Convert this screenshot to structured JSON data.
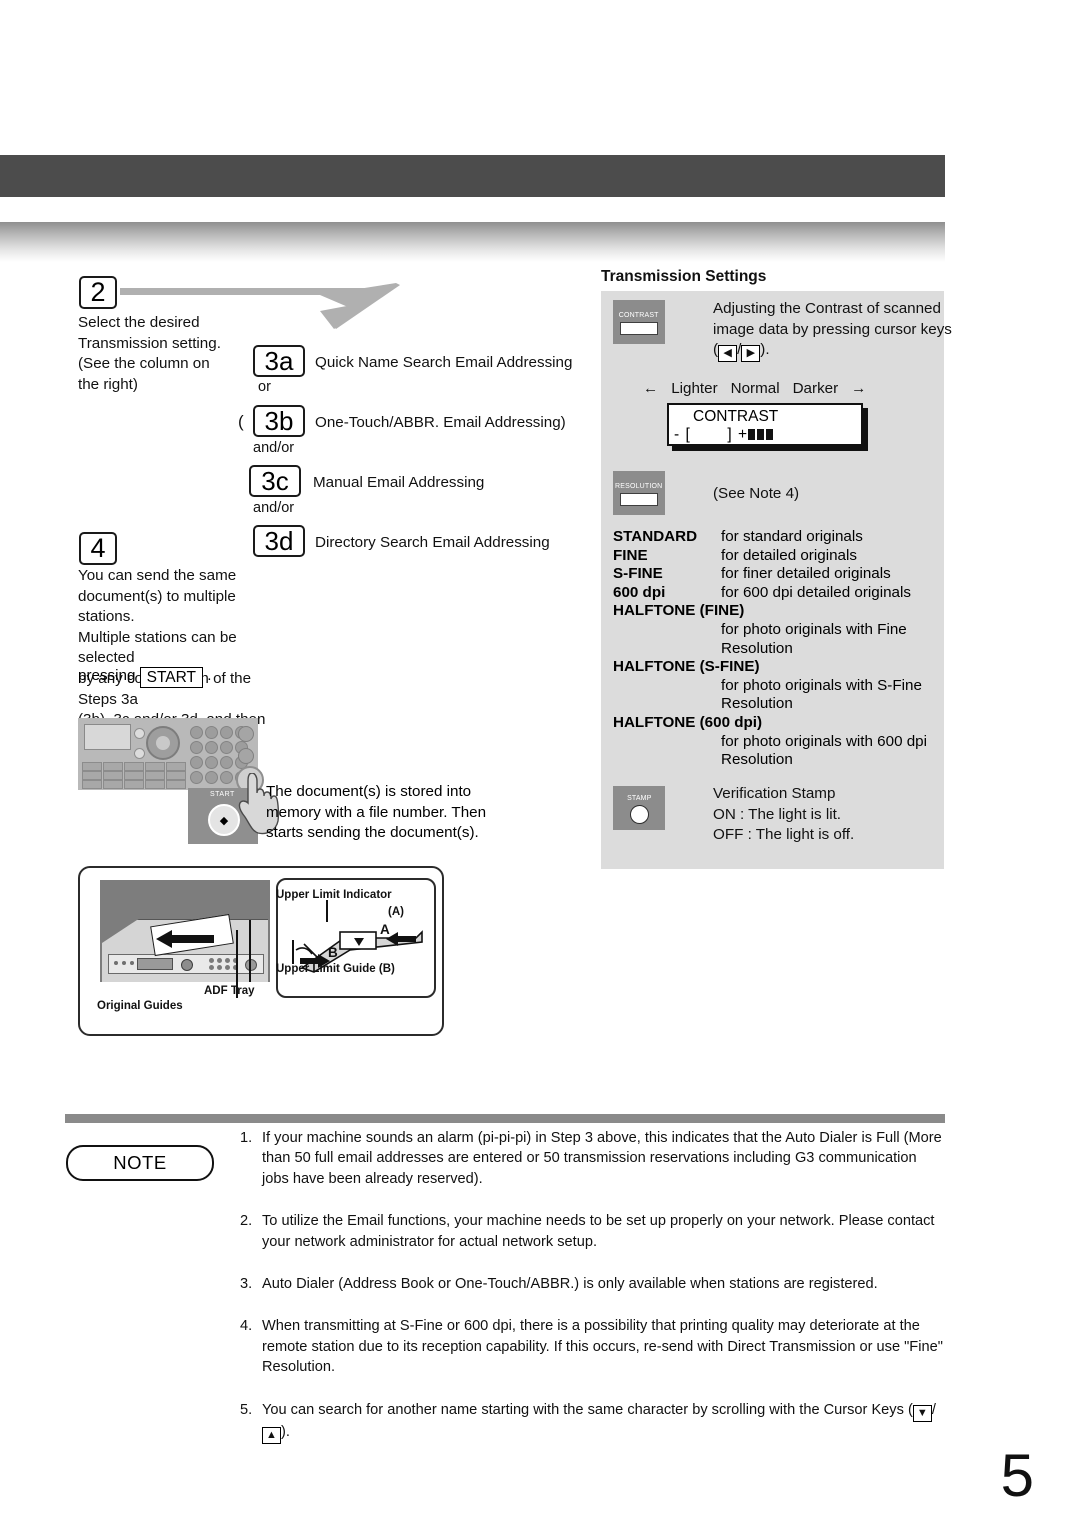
{
  "page": {
    "number": "5"
  },
  "steps": {
    "step2": {
      "number": "2",
      "text": "Select the desired\nTransmission setting.\n(See the column on\nthe right)"
    },
    "step4": {
      "number": "4",
      "text": "You can send the same\ndocument(s) to multiple stations.\nMultiple stations can be selected\nby any combination of the Steps 3a\n(3b), 3c and/or 3d, and then",
      "press_prefix": "pressing",
      "start_key": "START",
      "press_suffix": "."
    },
    "substeps": [
      {
        "id": "3a",
        "label": "Quick Name Search Email Addressing",
        "connector_after": "or"
      },
      {
        "id": "3b",
        "label": "One-Touch/ABBR. Email Addressing)",
        "paren_before": "(",
        "connector_after": "and/or"
      },
      {
        "id": "3c",
        "label": "Manual Email Addressing",
        "connector_after": "and/or"
      },
      {
        "id": "3d",
        "label": "Directory Search Email Addressing",
        "connector_after": ""
      }
    ]
  },
  "control_panel": {
    "start_button_label": "START",
    "caption": "The document(s) is stored into memory with a file number. Then starts sending the document(s)."
  },
  "adf_figure": {
    "upper_limit_indicator": "Upper Limit Indicator",
    "marker_a_paren": "(A)",
    "upper_limit_guide": "Upper Limit Guide (B)",
    "adf_tray": "ADF Tray",
    "original_guides": "Original Guides",
    "letter_a": "A",
    "letter_b": "B"
  },
  "transmission_settings": {
    "title": "Transmission Settings",
    "contrast": {
      "button_caption": "CONTRAST",
      "description_part1": "Adjusting the Contrast of scanned image data by pressing cursor keys (",
      "left_key": "◀",
      "slash": "/",
      "right_key": "▶",
      "description_part2": ").",
      "scale_left_arrow": "←",
      "scale_lighter": "Lighter",
      "scale_normal": "Normal",
      "scale_darker": "Darker",
      "scale_right_arrow": "→",
      "lcd_line1": "CONTRAST",
      "lcd_line2_prefix": "- [",
      "lcd_line2_mid": "] +",
      "lcd_bars_filled": 3
    },
    "resolution": {
      "button_caption": "RESOLUTION",
      "see_note": "(See Note 4)",
      "items": [
        {
          "name": "STANDARD",
          "desc": "for standard originals",
          "stacked": false
        },
        {
          "name": "FINE",
          "desc": "for detailed originals",
          "stacked": false
        },
        {
          "name": "S-FINE",
          "desc": "for finer detailed originals",
          "stacked": false
        },
        {
          "name": "600 dpi",
          "desc": "for 600 dpi detailed originals",
          "stacked": false
        },
        {
          "name": "HALFTONE (FINE)",
          "desc": "for photo originals with Fine Resolution",
          "stacked": true
        },
        {
          "name": "HALFTONE (S-FINE)",
          "desc": "for photo originals with S-Fine Resolution",
          "stacked": true
        },
        {
          "name": "HALFTONE (600 dpi)",
          "desc": "for photo originals with 600 dpi Resolution",
          "stacked": true
        }
      ]
    },
    "stamp": {
      "button_caption": "STAMP",
      "line1": "Verification Stamp",
      "line2": "ON  : The light is lit.",
      "line3": "OFF : The light is off."
    }
  },
  "note_section": {
    "label": "NOTE",
    "items": [
      {
        "num": "1.",
        "text": "If your machine sounds an alarm (pi-pi-pi) in Step 3 above, this indicates that the Auto Dialer is Full (More than 50 full email addresses are entered or 50 transmission reservations including G3 communication jobs have been already reserved)."
      },
      {
        "num": "2.",
        "text": "To utilize the Email functions, your machine needs to be set up properly on your network. Please contact your network administrator for actual network setup."
      },
      {
        "num": "3.",
        "text": "Auto Dialer (Address Book or One-Touch/ABBR.) is only available when stations are registered."
      },
      {
        "num": "4.",
        "text": "When transmitting at S-Fine or 600 dpi, there is a possibility that printing quality may deteriorate at the remote station due to its reception capability. If this occurs, re-send with Direct Transmission or use \"Fine\" Resolution."
      }
    ],
    "item5": {
      "num": "5.",
      "text_before": "You can search for another name starting with the same character by scrolling with the Cursor Keys (",
      "down_key": "▼",
      "slash": "/",
      "up_key": "▲",
      "text_after": ")."
    }
  },
  "colors": {
    "header_bar": "#4c4c4c",
    "panel_gray": "#dcdcdc",
    "button_gray": "#8c8c8c",
    "rule_gray": "#8a8a8a"
  }
}
